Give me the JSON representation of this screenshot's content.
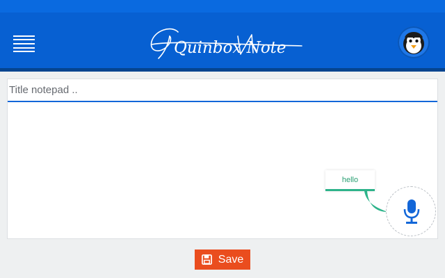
{
  "header": {
    "brand_logo_text": "Quinbox Note",
    "menu_icon": "hamburger-menu-icon",
    "avatar_icon": "penguin-avatar-icon"
  },
  "editor": {
    "title_placeholder": "Title notepad ..",
    "title_value": "",
    "note_value": ""
  },
  "voice": {
    "recognized_text": "hello",
    "mic_icon": "microphone-icon"
  },
  "actions": {
    "save_label": "Save",
    "save_icon": "floppy-disk-icon"
  },
  "colors": {
    "header_blue": "#0760d2",
    "accent_blue": "#1266d8",
    "save_orange": "#ea4d1e",
    "bubble_green": "#2db38a"
  }
}
